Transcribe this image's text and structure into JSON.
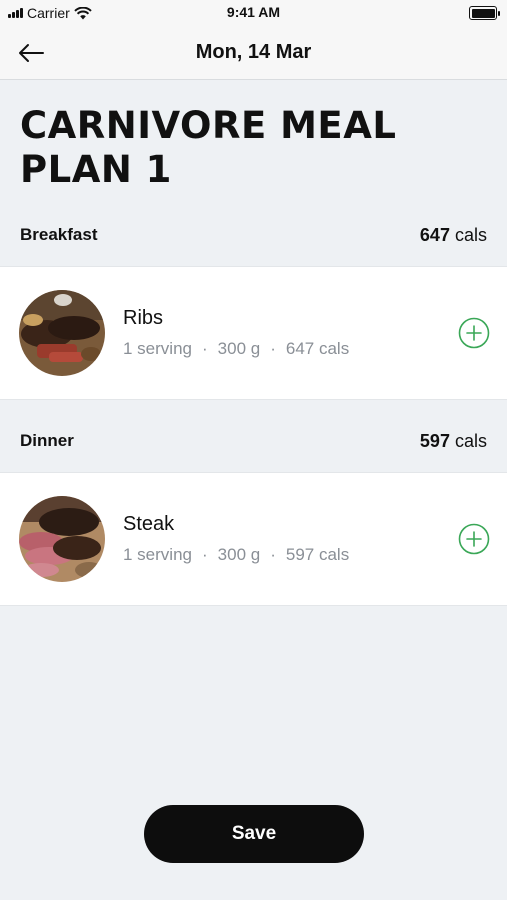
{
  "status_bar": {
    "carrier": "Carrier",
    "time": "9:41 AM"
  },
  "nav": {
    "title": "Mon, 14 Mar",
    "back_icon": "arrow-left-icon"
  },
  "plan": {
    "title": "CARNIVORE MEAL PLAN 1"
  },
  "sections": [
    {
      "name": "Breakfast",
      "cals_value": "647",
      "cals_unit": "cals",
      "meals": [
        {
          "name": "Ribs",
          "serving": "1 serving",
          "weight": "300 g",
          "cals": "647 cals",
          "image": "ribs-photo"
        }
      ]
    },
    {
      "name": "Dinner",
      "cals_value": "597",
      "cals_unit": "cals",
      "meals": [
        {
          "name": "Steak",
          "serving": "1 serving",
          "weight": "300 g",
          "cals": "597 cals",
          "image": "steak-photo"
        }
      ]
    }
  ],
  "actions": {
    "save_label": "Save"
  },
  "colors": {
    "accent_green": "#3aa757",
    "background": "#eef1f4",
    "button_dark": "#0d0d0d"
  }
}
